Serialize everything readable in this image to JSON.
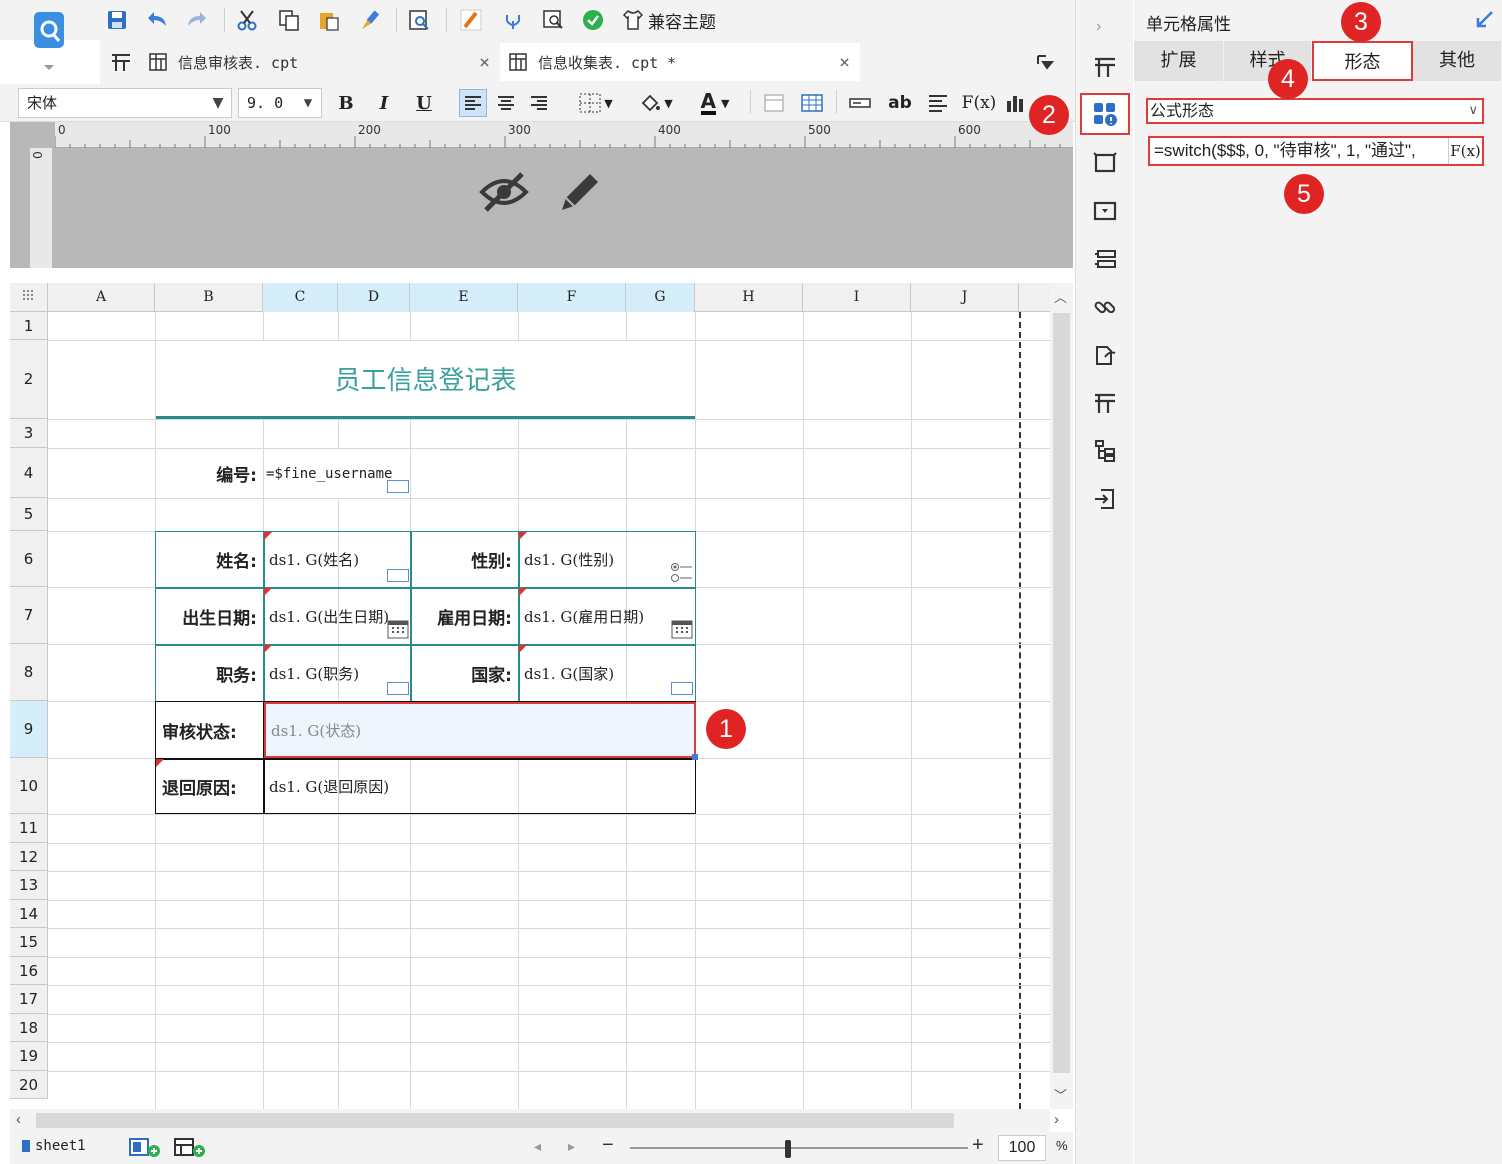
{
  "toolbar": {
    "theme_label": "兼容主题"
  },
  "tabs": [
    {
      "label": "信息审核表. cpt",
      "close": "×"
    },
    {
      "label": "信息收集表. cpt *",
      "close": "×"
    }
  ],
  "format": {
    "font_name": "宋体",
    "font_size": "9. 0",
    "bold": "B",
    "italic": "I",
    "underline": "U",
    "text_color": "A",
    "ab": "ab",
    "fx": "F(x)"
  },
  "ruler": {
    "h_ticks": [
      "0",
      "100",
      "200",
      "300",
      "400",
      "500",
      "600"
    ],
    "v_tick": "0"
  },
  "sheet": {
    "columns": [
      "A",
      "B",
      "C",
      "D",
      "E",
      "F",
      "G",
      "H",
      "I",
      "J"
    ],
    "rows": [
      "1",
      "2",
      "3",
      "4",
      "5",
      "6",
      "7",
      "8",
      "9",
      "10",
      "11",
      "12",
      "13",
      "14",
      "15",
      "16",
      "17",
      "18",
      "19",
      "20"
    ],
    "title": "员工信息登记表",
    "id_label": "编号:",
    "id_value": "=$fine_username",
    "name_label": "姓名:",
    "name_value": "ds1. G(姓名)",
    "gender_label": "性别:",
    "gender_value": "ds1. G(性别)",
    "birth_label": "出生日期:",
    "birth_value": "ds1. G(出生日期)",
    "hire_label": "雇用日期:",
    "hire_value": "ds1. G(雇用日期)",
    "job_label": "职务:",
    "job_value": "ds1. G(职务)",
    "country_label": "国家:",
    "country_value": "ds1. G(国家)",
    "status_label": "审核状态:",
    "status_value": "ds1. G(状态)",
    "reason_label": "退回原因:",
    "reason_value": "ds1. G(退回原因)"
  },
  "bottom": {
    "sheet_tab": "sheet1",
    "zoom_value": "100",
    "zoom_unit": "%",
    "minus": "−",
    "plus": "+"
  },
  "panel": {
    "title": "单元格属性",
    "tabs": [
      "扩展",
      "样式",
      "形态",
      "其他"
    ],
    "active_tab": "形态",
    "form_type": "公式形态",
    "formula": "=switch($$$, 0, \"待审核\", 1, \"通过\",",
    "fx": "F(x)"
  },
  "badges": [
    "1",
    "2",
    "3",
    "4",
    "5"
  ],
  "colors": {
    "accent_red": "#e02424",
    "title_teal": "#3aa0a0",
    "selection_blue": "#d6eefa"
  }
}
